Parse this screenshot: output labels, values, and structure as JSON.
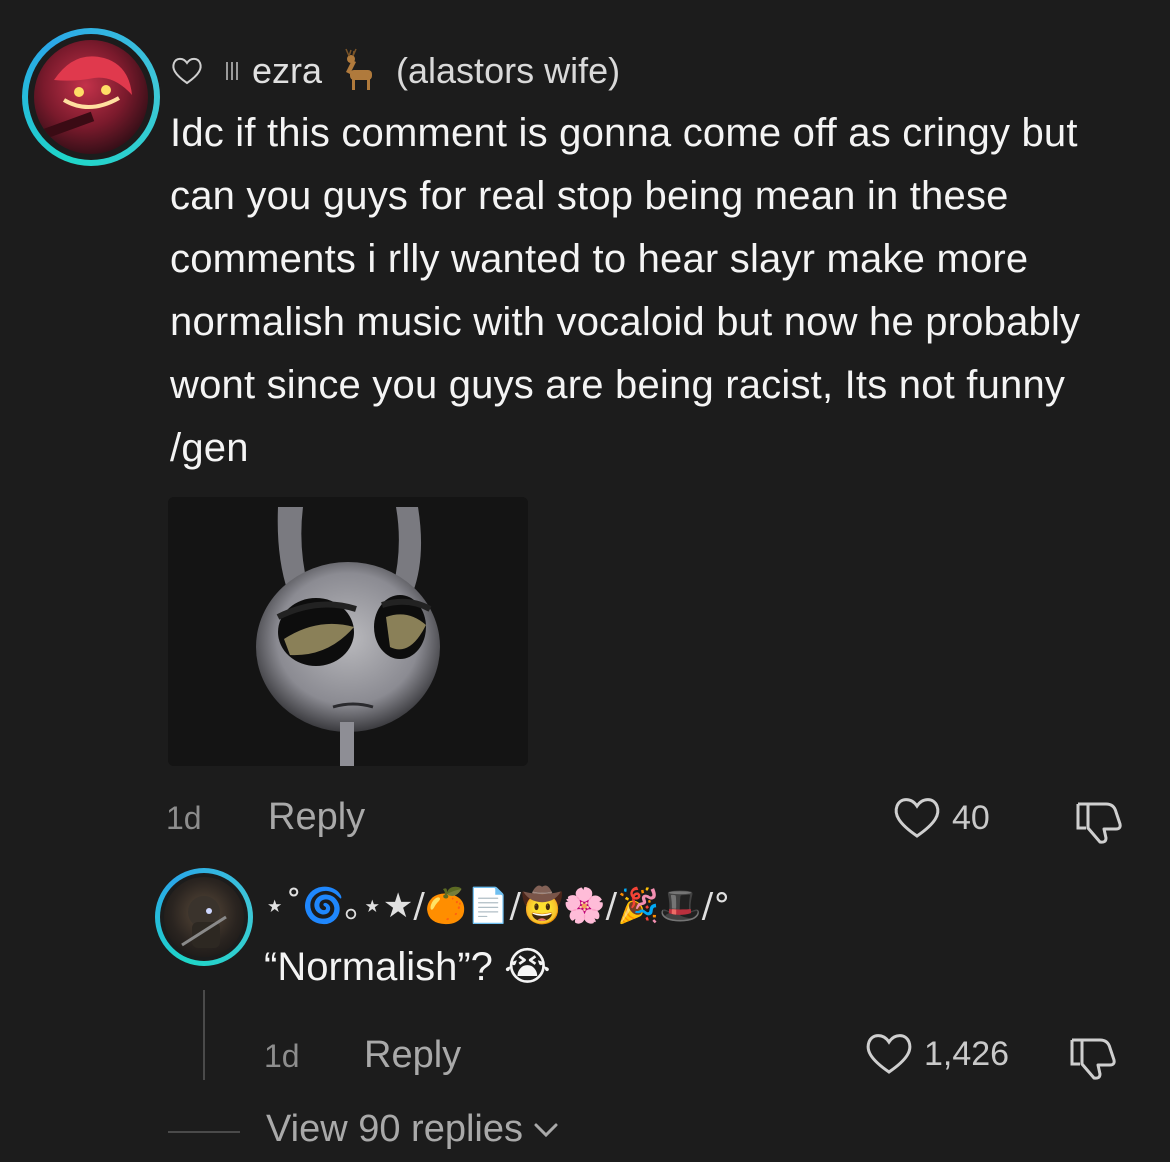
{
  "comment": {
    "username": "ezra",
    "username_suffix": "(alastors wife)",
    "badge_icon": "deer-emoji",
    "text": "Idc if this comment is gonna come off as cringy but can you guys for real stop being mean in these comments i rlly wanted to hear slayr make more normalish music with vocaloid but now he probably wont since you guys are being racist, Its not funny /gen",
    "age": "1d",
    "reply_label": "Reply",
    "likes": "40"
  },
  "reply": {
    "username": "⋆˚🌀｡⋆★/🍊📄/🤠🌸/🎉🎩/°",
    "text": "“Normalish”? 😭",
    "age": "1d",
    "reply_label": "Reply",
    "likes": "1,426"
  },
  "view_replies": {
    "label": "View 90 replies"
  },
  "colors": {
    "background": "#1c1c1c",
    "avatar_ring": "#1fd6c8",
    "text_primary": "#f4f4f4",
    "text_secondary": "#a9a9a9"
  }
}
